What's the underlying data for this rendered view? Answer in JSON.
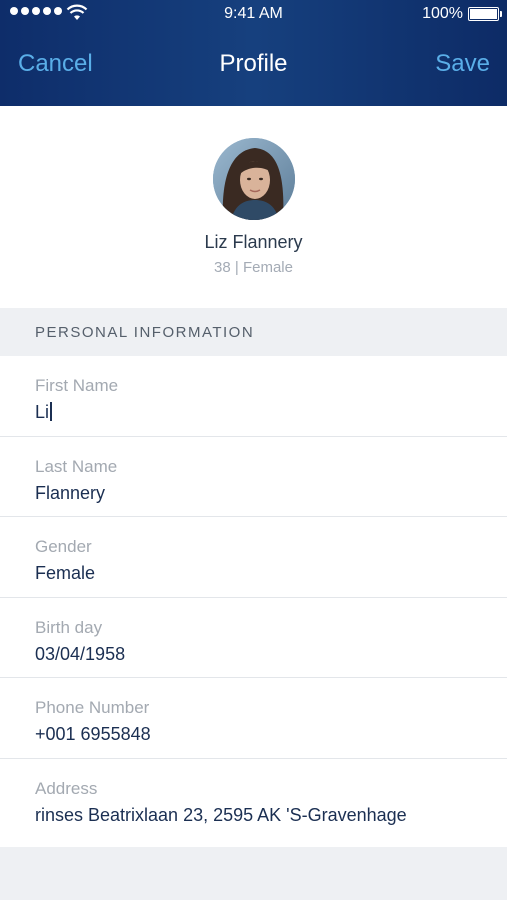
{
  "status_bar": {
    "time": "9:41 AM",
    "battery": "100%",
    "signal_icon": "signal-dots-icon",
    "wifi_icon": "wifi-icon",
    "battery_icon": "battery-icon"
  },
  "nav": {
    "cancel_label": "Cancel",
    "title": "Profile",
    "save_label": "Save",
    "accent_color": "#5aaee8",
    "bar_color": "#123571"
  },
  "profile": {
    "name": "Liz Flannery",
    "subtitle": "38 | Female"
  },
  "section": {
    "title": "PERSONAL INFORMATION"
  },
  "fields": [
    {
      "label": "First Name",
      "value": "Li"
    },
    {
      "label": "Last Name",
      "value": "Flannery"
    },
    {
      "label": "Gender",
      "value": "Female"
    },
    {
      "label": "Birth day",
      "value": "03/04/1958"
    },
    {
      "label": "Phone Number",
      "value": "+001 6955848"
    },
    {
      "label": "Address",
      "value": "rinses Beatrixlaan 23, 2595 AK  'S-Gravenhage"
    }
  ]
}
